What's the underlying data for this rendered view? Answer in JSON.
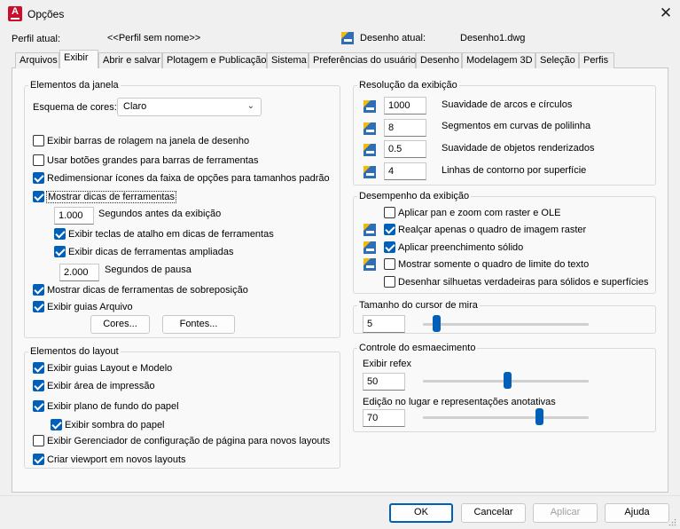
{
  "window": {
    "title": "Opções"
  },
  "header": {
    "profile_label": "Perfil atual:",
    "profile_value": "<<Perfil sem nome>>",
    "drawing_label": "Desenho atual:",
    "drawing_value": "Desenho1.dwg"
  },
  "tabs": [
    "Arquivos",
    "Exibir",
    "Abrir e salvar",
    "Plotagem e Publicação",
    "Sistema",
    "Preferências do usuário",
    "Desenho",
    "Modelagem 3D",
    "Seleção",
    "Perfis"
  ],
  "active_tab": "Exibir",
  "window_elements": {
    "title": "Elementos da janela",
    "color_scheme_label": "Esquema de cores:",
    "color_scheme_value": "Claro",
    "checks": [
      {
        "label": "Exibir barras de rolagem na janela de desenho",
        "checked": false
      },
      {
        "label": "Usar botões grandes para barras de ferramentas",
        "checked": false
      },
      {
        "label": "Redimensionar ícones da faixa de opções para tamanhos padrão",
        "checked": true
      },
      {
        "label": "Mostrar dicas de ferramentas",
        "checked": true
      }
    ],
    "tooltip_delay_value": "1.000",
    "tooltip_delay_label": "Segundos antes da exibição",
    "shortcut_keys_label": "Exibir teclas de atalho em dicas de ferramentas",
    "extended_tooltips_label": "Exibir dicas de ferramentas ampliadas",
    "pause_value": "2.000",
    "pause_label": "Segundos de pausa",
    "rollover_label": "Mostrar dicas de ferramentas de sobreposição",
    "file_tabs_label": "Exibir guias Arquivo",
    "colors_button": "Cores...",
    "fonts_button": "Fontes..."
  },
  "layout_elements": {
    "title": "Elementos do layout",
    "checks": [
      {
        "label": "Exibir guias Layout e Modelo",
        "checked": true
      },
      {
        "label": "Exibir área de impressão",
        "checked": true
      },
      {
        "label": "Exibir plano de fundo do papel",
        "checked": true
      }
    ],
    "paper_shadow_label": "Exibir sombra do papel",
    "page_setup_label": "Exibir Gerenciador de configuração de página para novos layouts",
    "viewport_label": "Criar viewport em novos layouts"
  },
  "resolution": {
    "title": "Resolução da exibição",
    "rows": [
      {
        "value": "1000",
        "label": "Suavidade de arcos e círculos"
      },
      {
        "value": "8",
        "label": "Segmentos em curvas de polilinha"
      },
      {
        "value": "0.5",
        "label": "Suavidade de objetos renderizados"
      },
      {
        "value": "4",
        "label": "Linhas de contorno por superfície"
      }
    ]
  },
  "performance": {
    "title": "Desempenho da exibição",
    "rows": [
      {
        "label": "Aplicar pan e zoom com raster e OLE",
        "checked": false,
        "icon": false
      },
      {
        "label": "Realçar apenas o quadro de imagem raster",
        "checked": true,
        "icon": true
      },
      {
        "label": "Aplicar preenchimento sólido",
        "checked": true,
        "icon": true
      },
      {
        "label": "Mostrar somente o quadro de limite do texto",
        "checked": false,
        "icon": true
      },
      {
        "label": "Desenhar silhuetas verdadeiras para sólidos e superfícies",
        "checked": false,
        "icon": false
      }
    ]
  },
  "crosshair": {
    "title": "Tamanho do cursor de mira",
    "value": "5",
    "level": 0.05
  },
  "fade": {
    "title": "Controle do esmaecimento",
    "xref_label": "Exibir refex",
    "xref_value": "50",
    "xref_level": 0.5,
    "inplace_label": "Edição no lugar e representações anotativas",
    "inplace_value": "70",
    "inplace_level": 0.7
  },
  "buttons": {
    "ok": "OK",
    "cancel": "Cancelar",
    "apply": "Aplicar",
    "help": "Ajuda"
  },
  "colors": {
    "accent": "#005fb8",
    "icon_blue": "#2f6db5",
    "icon_yellow": "#f2b90f"
  }
}
